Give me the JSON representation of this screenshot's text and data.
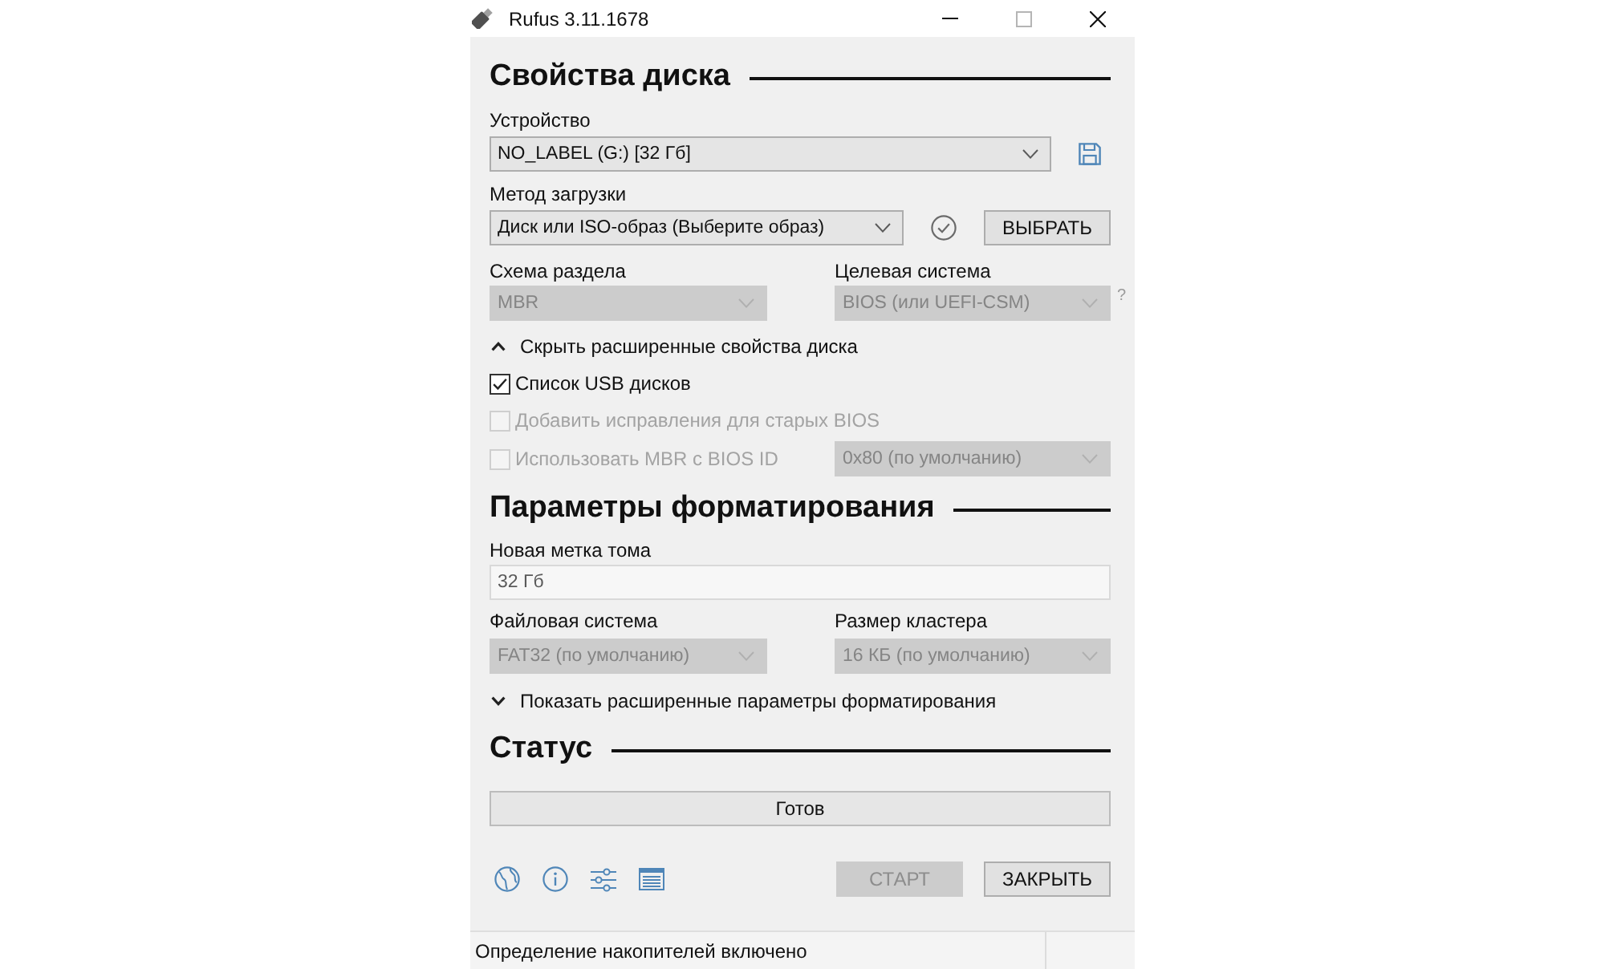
{
  "window": {
    "title": "Rufus 3.11.1678"
  },
  "drive_properties": {
    "heading": "Свойства диска",
    "device": {
      "label": "Устройство",
      "value": "NO_LABEL (G:) [32 Гб]",
      "disabled": false
    },
    "boot_selection": {
      "label": "Метод загрузки",
      "value": "Диск или ISO-образ (Выберите образ)",
      "disabled": false
    },
    "select_button": {
      "label": "ВЫБРАТЬ",
      "disabled": false
    },
    "partition_scheme": {
      "label": "Схема раздела",
      "value": "MBR",
      "disabled": true
    },
    "target_system": {
      "label": "Целевая система",
      "value": "BIOS (или UEFI-CSM)",
      "disabled": true,
      "help": "?"
    },
    "advanced_toggle": {
      "label": "Скрыть расширенные свойства диска",
      "expanded": true
    },
    "options": [
      {
        "label": "Список USB дисков",
        "checked": true,
        "disabled": false
      },
      {
        "label": "Добавить исправления для старых BIOS",
        "checked": false,
        "disabled": true
      },
      {
        "label": "Использовать MBR с BIOS ID",
        "checked": false,
        "disabled": true,
        "dropdown": {
          "value": "0x80 (по умолчанию)",
          "disabled": true
        }
      }
    ]
  },
  "format_options": {
    "heading": "Параметры форматирования",
    "volume_label": {
      "label": "Новая метка тома",
      "value": "32 Гб"
    },
    "file_system": {
      "label": "Файловая система",
      "value": "FAT32 (по умолчанию)",
      "disabled": true
    },
    "cluster_size": {
      "label": "Размер кластера",
      "value": "16 КБ (по умолчанию)",
      "disabled": true
    },
    "advanced_toggle": {
      "label": "Показать расширенные параметры форматирования",
      "expanded": false
    }
  },
  "status": {
    "heading": "Статус",
    "progress": {
      "text": "Готов",
      "level": 0
    },
    "buttons": [
      {
        "label": "СТАРТ",
        "disabled": true
      },
      {
        "label": "ЗАКРЫТЬ",
        "disabled": false
      }
    ]
  },
  "status_bar": {
    "text": "Определение накопителей включено"
  }
}
